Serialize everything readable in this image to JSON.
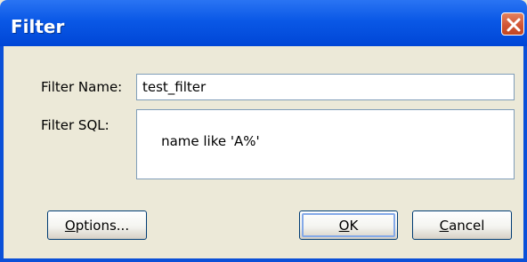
{
  "window": {
    "title": "Filter",
    "close_icon": "close-icon"
  },
  "form": {
    "name_label": "Filter Name:",
    "name_value": "test_filter",
    "sql_label": "Filter SQL:",
    "sql_value": "name like 'A%'"
  },
  "buttons": {
    "options_mnemonic": "O",
    "options_rest": "ptions...",
    "ok_mnemonic": "O",
    "ok_rest": "K",
    "cancel_mnemonic": "C",
    "cancel_rest": "ancel"
  },
  "colors": {
    "titlebar": "#0a58e6",
    "close_button": "#d25636",
    "dialog_background": "#ece9d8",
    "input_border": "#7f9db9"
  }
}
